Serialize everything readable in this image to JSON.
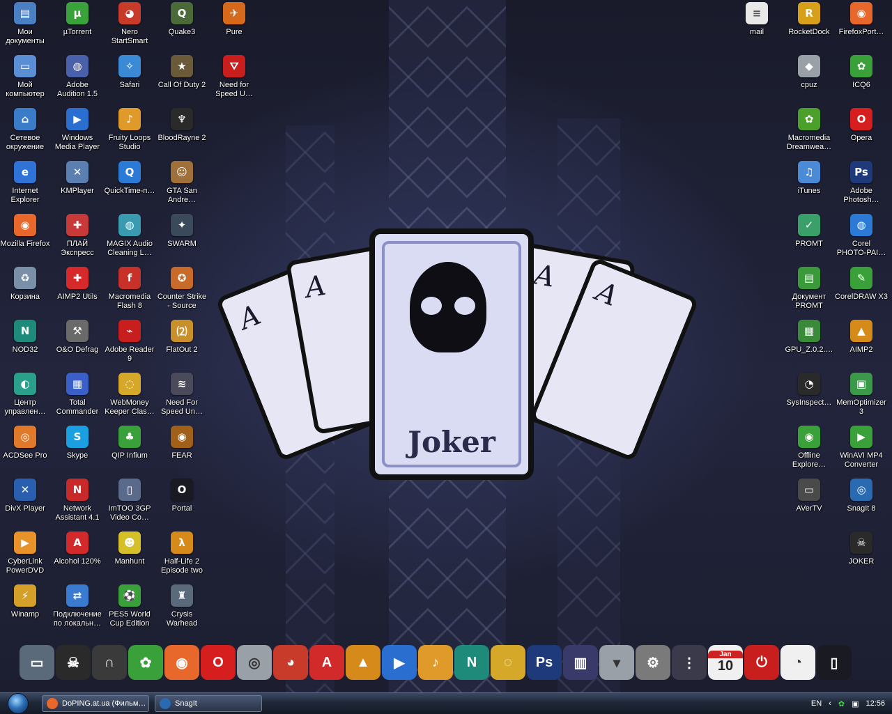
{
  "desktop_icons": {
    "col1": [
      {
        "label": "Мои\nдокументы",
        "icon": "my-documents-icon",
        "color": "#4a7fc4",
        "glyph": "▤"
      },
      {
        "label": "Мой\nкомпьютер",
        "icon": "my-computer-icon",
        "color": "#5a8fd6",
        "glyph": "▭"
      },
      {
        "label": "Сетевое\nокружение",
        "icon": "network-icon",
        "color": "#3b7cc9",
        "glyph": "⌂"
      },
      {
        "label": "Internet\nExplorer",
        "icon": "internet-explorer-icon",
        "color": "#2f73d6",
        "glyph": "e"
      },
      {
        "label": "Mozilla Firefox",
        "icon": "firefox-icon",
        "color": "#e8672a",
        "glyph": "◉"
      },
      {
        "label": "Корзина",
        "icon": "recycle-bin-icon",
        "color": "#7a8fa8",
        "glyph": "♻"
      },
      {
        "label": "NOD32",
        "icon": "nod32-icon",
        "color": "#1e8a7a",
        "glyph": "N"
      },
      {
        "label": "Центр\nуправлен…",
        "icon": "control-center-icon",
        "color": "#2aa08a",
        "glyph": "◐"
      },
      {
        "label": "ACDSee Pro",
        "icon": "acdsee-icon",
        "color": "#e07a2a",
        "glyph": "◎"
      },
      {
        "label": "DivX Player",
        "icon": "divx-icon",
        "color": "#2a5fb0",
        "glyph": "✕"
      },
      {
        "label": "CyberLink\nPowerDVD",
        "icon": "powerdvd-icon",
        "color": "#e8932a",
        "glyph": "▶"
      },
      {
        "label": "Winamp",
        "icon": "winamp-icon",
        "color": "#d4a02a",
        "glyph": "⚡"
      }
    ],
    "col2": [
      {
        "label": "µTorrent",
        "icon": "utorrent-icon",
        "color": "#3aa23a",
        "glyph": "µ"
      },
      {
        "label": "Adobe\nAudition 1.5",
        "icon": "audition-icon",
        "color": "#4a60a8",
        "glyph": "◍"
      },
      {
        "label": "Windows\nMedia Player",
        "icon": "media-player-icon",
        "color": "#2a6fd0",
        "glyph": "▶"
      },
      {
        "label": "KMPlayer",
        "icon": "kmplayer-icon",
        "color": "#5a7fb0",
        "glyph": "✕"
      },
      {
        "label": "ПЛАЙ\nЭкспресс",
        "icon": "play-express-icon",
        "color": "#c83a3a",
        "glyph": "✚"
      },
      {
        "label": "AIMP2 Utils",
        "icon": "aimp-utils-icon",
        "color": "#d62a2a",
        "glyph": "✚"
      },
      {
        "label": "O&O Defrag",
        "icon": "defrag-icon",
        "color": "#6a6a6a",
        "glyph": "⚒"
      },
      {
        "label": "Total\nCommander",
        "icon": "total-commander-icon",
        "color": "#3a5fc8",
        "glyph": "▦"
      },
      {
        "label": "Skype",
        "icon": "skype-icon",
        "color": "#1aa0e0",
        "glyph": "S"
      },
      {
        "label": "Network\nAssistant 4.1",
        "icon": "network-assistant-icon",
        "color": "#c82a2a",
        "glyph": "N"
      },
      {
        "label": "Alcohol 120%",
        "icon": "alcohol-icon",
        "color": "#d22a2a",
        "glyph": "A"
      },
      {
        "label": "Подключение\nпо локальн…",
        "icon": "local-connection-icon",
        "color": "#3a7ad0",
        "glyph": "⇄"
      }
    ],
    "col3": [
      {
        "label": "Nero\nStartSmart",
        "icon": "nero-icon",
        "color": "#c83a2a",
        "glyph": "◕"
      },
      {
        "label": "Safari",
        "icon": "safari-icon",
        "color": "#3a8ad6",
        "glyph": "✧"
      },
      {
        "label": "Fruity Loops\nStudio",
        "icon": "fruity-loops-icon",
        "color": "#e09a2a",
        "glyph": "♪"
      },
      {
        "label": "QuickTime-п…",
        "icon": "quicktime-icon",
        "color": "#2a7ad6",
        "glyph": "Q"
      },
      {
        "label": "MAGIX Audio\nCleaning L…",
        "icon": "magix-icon",
        "color": "#3a9ab0",
        "glyph": "◍"
      },
      {
        "label": "Macromedia\nFlash 8",
        "icon": "flash-icon",
        "color": "#c8302a",
        "glyph": "f"
      },
      {
        "label": "Adobe Reader\n9",
        "icon": "adobe-reader-icon",
        "color": "#c81e1e",
        "glyph": "⌁"
      },
      {
        "label": "WebMoney\nKeeper Clas…",
        "icon": "webmoney-icon",
        "color": "#d6a82a",
        "glyph": "◌"
      },
      {
        "label": "QIP Infium",
        "icon": "qip-icon",
        "color": "#3aa03a",
        "glyph": "♣"
      },
      {
        "label": "ImTOO 3GP\nVideo Co…",
        "icon": "imtoo-icon",
        "color": "#5a6a8a",
        "glyph": "▯"
      },
      {
        "label": "Manhunt",
        "icon": "manhunt-icon",
        "color": "#d6c02a",
        "glyph": "☻"
      },
      {
        "label": "PES5 World\nCup Edition",
        "icon": "pes5-icon",
        "color": "#3aa03a",
        "glyph": "⚽"
      }
    ],
    "col4": [
      {
        "label": "Quake3",
        "icon": "quake3-icon",
        "color": "#4a6a3a",
        "glyph": "Q"
      },
      {
        "label": "Call Of Duty 2",
        "icon": "call-of-duty-icon",
        "color": "#6a5a3a",
        "glyph": "★"
      },
      {
        "label": "BloodRayne 2",
        "icon": "bloodrayne-icon",
        "color": "#2a2a2a",
        "glyph": "♆"
      },
      {
        "label": "GTA San\nAndre…",
        "icon": "gta-icon",
        "color": "#a0703a",
        "glyph": "☺"
      },
      {
        "label": "SWARM",
        "icon": "swarm-icon",
        "color": "#3a4a5a",
        "glyph": "✦"
      },
      {
        "label": "Counter Strike\n- Source",
        "icon": "counter-strike-icon",
        "color": "#c86a2a",
        "glyph": "✪"
      },
      {
        "label": "FlatOut 2",
        "icon": "flatout-icon",
        "color": "#c8902a",
        "glyph": "⑵"
      },
      {
        "label": "Need For\nSpeed Un…",
        "icon": "nfs-underground-icon",
        "color": "#4a4a5a",
        "glyph": "≋"
      },
      {
        "label": "FEAR",
        "icon": "fear-icon",
        "color": "#a0601a",
        "glyph": "◉"
      },
      {
        "label": "Portal",
        "icon": "portal-icon",
        "color": "#1a1a22",
        "glyph": "O"
      },
      {
        "label": "Half-Life 2\nEpisode two",
        "icon": "half-life-icon",
        "color": "#d68a1a",
        "glyph": "λ"
      },
      {
        "label": "Crysis\nWarhead",
        "icon": "crysis-icon",
        "color": "#5a6a7a",
        "glyph": "♜"
      }
    ],
    "col5": [
      {
        "label": "Pure",
        "icon": "pure-icon",
        "color": "#d66a1a",
        "glyph": "✈"
      },
      {
        "label": "Need for\nSpeed U…",
        "icon": "nfs-undercover-icon",
        "color": "#c81e1e",
        "glyph": "⛛"
      }
    ],
    "right1": [
      {
        "label": "mail",
        "icon": "mail-document-icon",
        "color": "#e8e8e8",
        "glyph": "≡"
      }
    ],
    "right2": [
      {
        "label": "RocketDock",
        "icon": "rocketdock-icon",
        "color": "#d6a01a",
        "glyph": "R"
      },
      {
        "label": "cpuz",
        "icon": "cpuz-icon",
        "color": "#9aa0a8",
        "glyph": "◆"
      },
      {
        "label": "Macromedia\nDreamwea…",
        "icon": "dreamweaver-icon",
        "color": "#4aa02a",
        "glyph": "✿"
      },
      {
        "label": "iTunes",
        "icon": "itunes-icon",
        "color": "#4a8ad6",
        "glyph": "♫"
      },
      {
        "label": "PROMT",
        "icon": "promt-icon",
        "color": "#3aa06a",
        "glyph": "✓"
      },
      {
        "label": "Документ\nPROMT",
        "icon": "promt-document-icon",
        "color": "#3a9a3a",
        "glyph": "▤"
      },
      {
        "label": "GPU_Z.0.2.…",
        "icon": "gpuz-icon",
        "color": "#3a8a3a",
        "glyph": "▦"
      },
      {
        "label": "SysInspect…",
        "icon": "sysinspector-icon",
        "color": "#2a2a2a",
        "glyph": "◔"
      },
      {
        "label": "Offline\nExplore…",
        "icon": "offline-explorer-icon",
        "color": "#3aa03a",
        "glyph": "◉"
      },
      {
        "label": "AVerTV",
        "icon": "avertv-icon",
        "color": "#4a4a4a",
        "glyph": "▭"
      }
    ],
    "right3": [
      {
        "label": "FirefoxPort…",
        "icon": "firefox-portable-icon",
        "color": "#e8672a",
        "glyph": "◉"
      },
      {
        "label": "ICQ6",
        "icon": "icq-icon",
        "color": "#3aa03a",
        "glyph": "✿"
      },
      {
        "label": "Opera",
        "icon": "opera-icon",
        "color": "#d61e1e",
        "glyph": "O"
      },
      {
        "label": "Adobe\nPhotosh…",
        "icon": "photoshop-icon",
        "color": "#1e3a7a",
        "glyph": "Ps"
      },
      {
        "label": "Corel\nPHOTO-PAI…",
        "icon": "corel-photopaint-icon",
        "color": "#2a7ad6",
        "glyph": "◍"
      },
      {
        "label": "CorelDRAW X3",
        "icon": "coreldraw-icon",
        "color": "#3aa03a",
        "glyph": "✎"
      },
      {
        "label": "AIMP2",
        "icon": "aimp2-icon",
        "color": "#d68a1a",
        "glyph": "▲"
      },
      {
        "label": "MemOptimizer\n3",
        "icon": "memoptimizer-icon",
        "color": "#3a9a4a",
        "glyph": "▣"
      },
      {
        "label": "WinAVI MP4\nConverter",
        "icon": "winavi-icon",
        "color": "#3aa03a",
        "glyph": "▶"
      },
      {
        "label": "SnagIt 8",
        "icon": "snagit-icon",
        "color": "#2a6ab0",
        "glyph": "◎"
      },
      {
        "label": "JOKER",
        "icon": "joker-icon",
        "color": "#2a2a2a",
        "glyph": "☠"
      }
    ]
  },
  "wallpaper": {
    "card_text": "Joker",
    "card_letter": "A"
  },
  "dock_items": [
    {
      "icon": "screenshot-thumb-icon",
      "color": "#5a6a7a",
      "glyph": "▭"
    },
    {
      "icon": "joker-dock-icon",
      "color": "#2a2a2a",
      "glyph": "☠"
    },
    {
      "icon": "headphones-icon",
      "color": "#3a3a3a",
      "glyph": "∩"
    },
    {
      "icon": "icq-dock-icon",
      "color": "#3aa03a",
      "glyph": "✿"
    },
    {
      "icon": "firefox-dock-icon",
      "color": "#e8672a",
      "glyph": "◉"
    },
    {
      "icon": "opera-dock-icon",
      "color": "#d61e1e",
      "glyph": "O"
    },
    {
      "icon": "acdsee-dock-icon",
      "color": "#9aa0a8",
      "glyph": "◎"
    },
    {
      "icon": "nero-dock-icon",
      "color": "#c83a2a",
      "glyph": "◕"
    },
    {
      "icon": "alcohol-dock-icon",
      "color": "#d22a2a",
      "glyph": "A"
    },
    {
      "icon": "aimp-dock-icon",
      "color": "#d68a1a",
      "glyph": "▲"
    },
    {
      "icon": "media-player-dock-icon",
      "color": "#2a6fd0",
      "glyph": "▶"
    },
    {
      "icon": "fruity-loops-dock-icon",
      "color": "#e09a2a",
      "glyph": "♪"
    },
    {
      "icon": "nod32-dock-icon",
      "color": "#1e8a7a",
      "glyph": "N"
    },
    {
      "icon": "webmoney-dock-icon",
      "color": "#d6a82a",
      "glyph": "◌"
    },
    {
      "icon": "photoshop-dock-icon",
      "color": "#1e3a7a",
      "glyph": "Ps"
    },
    {
      "icon": "equalizer-dock-icon",
      "color": "#3a3a6a",
      "glyph": "▥"
    },
    {
      "icon": "dropdown-dock-icon",
      "color": "#9aa0a8",
      "glyph": "▾"
    },
    {
      "icon": "settings-dock-icon",
      "color": "#7a7a7a",
      "glyph": "⚙"
    },
    {
      "icon": "separator-dock-icon",
      "color": "#3a3a4a",
      "glyph": "⋮"
    },
    {
      "icon": "calendar-dock-icon",
      "color": "#f0f0f0",
      "glyph": "10"
    },
    {
      "icon": "shutdown-dock-icon",
      "color": "#c81e1e",
      "glyph": "⏻"
    },
    {
      "icon": "clock-dock-icon",
      "color": "#f0f0f0",
      "glyph": "◔"
    },
    {
      "icon": "trash-dock-icon",
      "color": "#1a1a22",
      "glyph": "▯"
    }
  ],
  "calendar": {
    "month": "Jan",
    "day": "10"
  },
  "taskbar": {
    "tasks": [
      {
        "label": "DoPING.at.ua (Фильм…",
        "icon": "firefox-task-icon",
        "color": "#e8672a"
      },
      {
        "label": "SnagIt",
        "icon": "snagit-task-icon",
        "color": "#2a6ab0"
      }
    ],
    "tray": {
      "lang": "EN",
      "time": "12:56"
    }
  }
}
